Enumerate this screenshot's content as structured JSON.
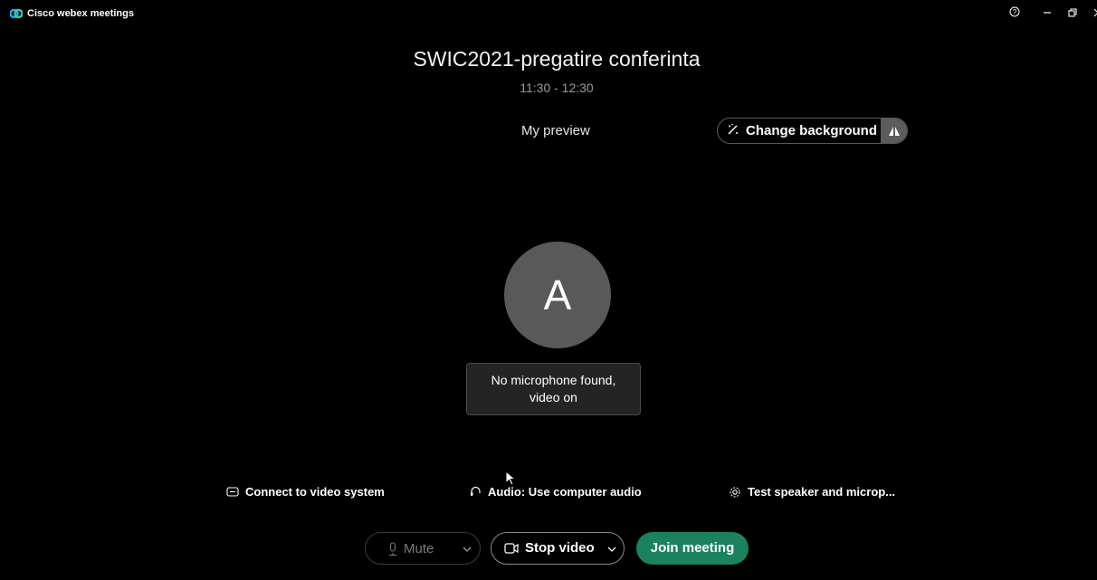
{
  "window": {
    "app_title": "Cisco webex meetings",
    "controls": [
      "help-icon",
      "minimize-icon",
      "restore-icon",
      "close-icon"
    ]
  },
  "meeting": {
    "title": "SWIC2021-pregatire conferinta",
    "time": "11:30 - 12:30"
  },
  "preview": {
    "label": "My preview",
    "change_background_label": "Change background",
    "avatar_initial": "A",
    "status_line1": "No microphone found,",
    "status_line2": "video on"
  },
  "options": {
    "connect_video": "Connect to video system",
    "audio": "Audio: Use computer audio",
    "test_speaker": "Test speaker and microp..."
  },
  "controls": {
    "mute_label": "Mute",
    "stop_video_label": "Stop video",
    "join_label": "Join meeting"
  },
  "colors": {
    "background": "#000000",
    "join_accent": "#1c8160",
    "avatar": "#595959"
  }
}
